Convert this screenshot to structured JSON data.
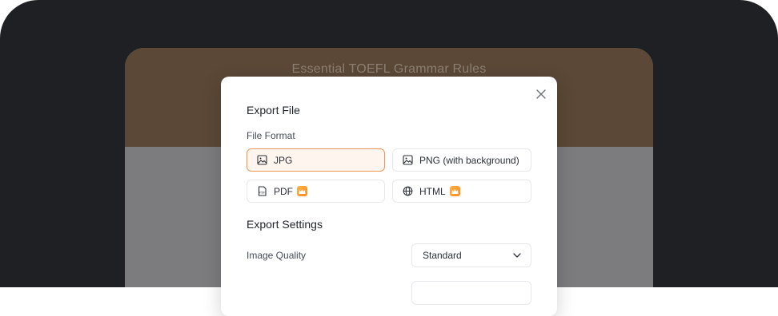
{
  "document": {
    "title": "Essential TOEFL Grammar Rules"
  },
  "modal": {
    "title": "Export File",
    "file_format_label": "File Format",
    "formats": [
      {
        "label": "JPG",
        "icon": "image-icon",
        "selected": true,
        "premium": false
      },
      {
        "label": "PNG (with background)",
        "icon": "image-icon",
        "selected": false,
        "premium": false
      },
      {
        "label": "PDF",
        "icon": "pdf-file-icon",
        "selected": false,
        "premium": true
      },
      {
        "label": "HTML",
        "icon": "globe-icon",
        "selected": false,
        "premium": true
      }
    ],
    "settings_title": "Export Settings",
    "image_quality_label": "Image Quality",
    "image_quality_value": "Standard"
  },
  "colors": {
    "accent": "#e8965a",
    "premium_badge": "#ff9a2e",
    "header_brown": "#5b4837",
    "background": "#1f2024"
  }
}
